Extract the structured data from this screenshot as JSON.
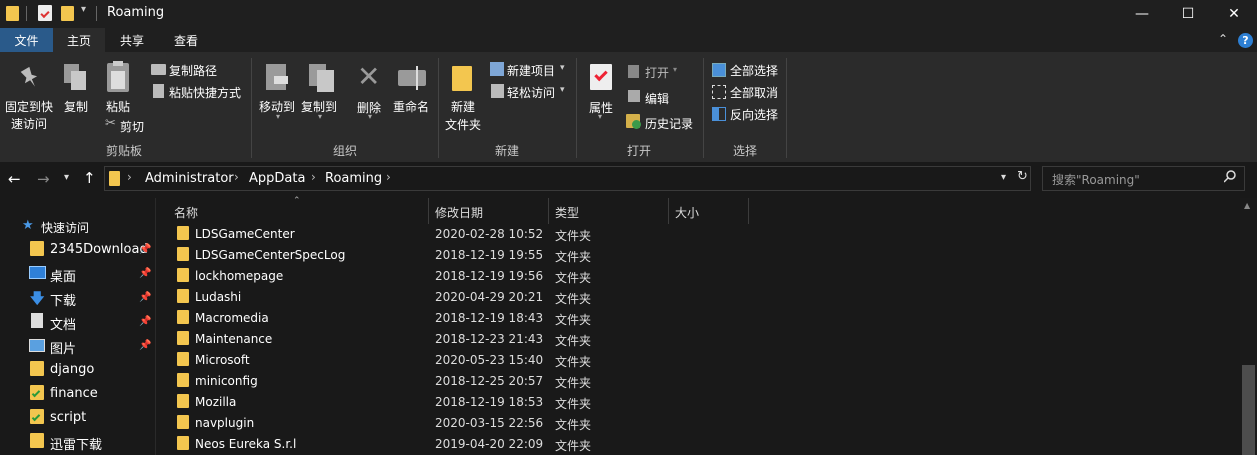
{
  "window": {
    "title": "Roaming",
    "minimize": "—",
    "maximize": "☐",
    "close": "✕"
  },
  "tabs": [
    "文件",
    "主页",
    "共享",
    "查看"
  ],
  "ribbon": {
    "clipboard": {
      "pin_l1": "固定到快",
      "pin_l2": "速访问",
      "copy": "复制",
      "paste": "粘贴",
      "copy_path": "复制路径",
      "paste_shortcut": "粘贴快捷方式",
      "cut": "剪切",
      "group": "剪贴板"
    },
    "organize": {
      "move_to": "移动到",
      "copy_to": "复制到",
      "delete": "删除",
      "rename": "重命名",
      "group": "组织"
    },
    "new": {
      "new_folder_l1": "新建",
      "new_folder_l2": "文件夹",
      "new_item": "新建项目",
      "easy_access": "轻松访问",
      "group": "新建"
    },
    "open": {
      "properties": "属性",
      "open": "打开",
      "edit": "编辑",
      "history": "历史记录",
      "group": "打开"
    },
    "select": {
      "select_all": "全部选择",
      "select_none": "全部取消",
      "invert": "反向选择",
      "group": "选择"
    }
  },
  "address": {
    "crumbs": [
      "Administrator",
      "AppData",
      "Roaming"
    ],
    "search_placeholder": "搜索\"Roaming\""
  },
  "nav": {
    "quick_access": "快速访问",
    "items": [
      {
        "label": "2345Download",
        "pinned": true,
        "icon": "folder-icon"
      },
      {
        "label": "桌面",
        "pinned": true,
        "icon": "desktop-icon"
      },
      {
        "label": "下载",
        "pinned": true,
        "icon": "download-icon"
      },
      {
        "label": "文档",
        "pinned": true,
        "icon": "documents-icon"
      },
      {
        "label": "图片",
        "pinned": true,
        "icon": "pictures-icon"
      },
      {
        "label": "django",
        "pinned": false,
        "icon": "folder-icon"
      },
      {
        "label": "finance",
        "pinned": false,
        "icon": "folder-check-icon"
      },
      {
        "label": "script",
        "pinned": false,
        "icon": "folder-check-icon"
      },
      {
        "label": "迅雷下载",
        "pinned": false,
        "icon": "folder-icon"
      }
    ]
  },
  "list": {
    "columns": [
      "名称",
      "修改日期",
      "类型",
      "大小"
    ],
    "rows": [
      {
        "name": "LDSGameCenter",
        "date": "2020-02-28 10:52",
        "type": "文件夹"
      },
      {
        "name": "LDSGameCenterSpecLog",
        "date": "2018-12-19 19:55",
        "type": "文件夹"
      },
      {
        "name": "lockhomepage",
        "date": "2018-12-19 19:56",
        "type": "文件夹"
      },
      {
        "name": "Ludashi",
        "date": "2020-04-29 20:21",
        "type": "文件夹"
      },
      {
        "name": "Macromedia",
        "date": "2018-12-19 18:43",
        "type": "文件夹"
      },
      {
        "name": "Maintenance",
        "date": "2018-12-23 21:43",
        "type": "文件夹"
      },
      {
        "name": "Microsoft",
        "date": "2020-05-23 15:40",
        "type": "文件夹"
      },
      {
        "name": "miniconfig",
        "date": "2018-12-25 20:57",
        "type": "文件夹"
      },
      {
        "name": "Mozilla",
        "date": "2018-12-19 18:53",
        "type": "文件夹"
      },
      {
        "name": "navplugin",
        "date": "2020-03-15 22:56",
        "type": "文件夹"
      },
      {
        "name": "Neos Eureka S.r.l",
        "date": "2019-04-20 22:09",
        "type": "文件夹"
      }
    ]
  }
}
